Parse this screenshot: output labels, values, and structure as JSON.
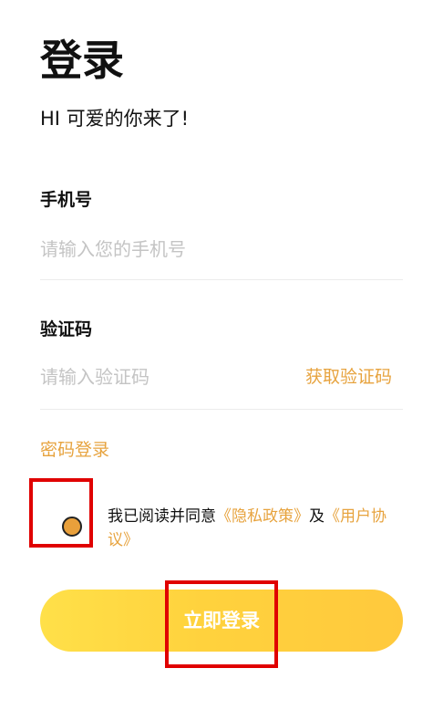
{
  "header": {
    "title": "登录",
    "subtitle": "HI 可爱的你来了!"
  },
  "phone": {
    "label": "手机号",
    "placeholder": "请输入您的手机号",
    "value": ""
  },
  "code": {
    "label": "验证码",
    "placeholder": "请输入验证码",
    "value": "",
    "get_code_label": "获取验证码"
  },
  "password_login_label": "密码登录",
  "agreement": {
    "checked": true,
    "prefix": "我已阅读并同意",
    "privacy_link": "《隐私政策》",
    "conjunction": "及",
    "terms_link": "《用户协议》"
  },
  "submit": {
    "label": "立即登录"
  },
  "colors": {
    "accent": "#e7a33e",
    "button_gradient_start": "#ffe049",
    "button_gradient_end": "#ffc93d",
    "highlight_box": "#e00000"
  }
}
